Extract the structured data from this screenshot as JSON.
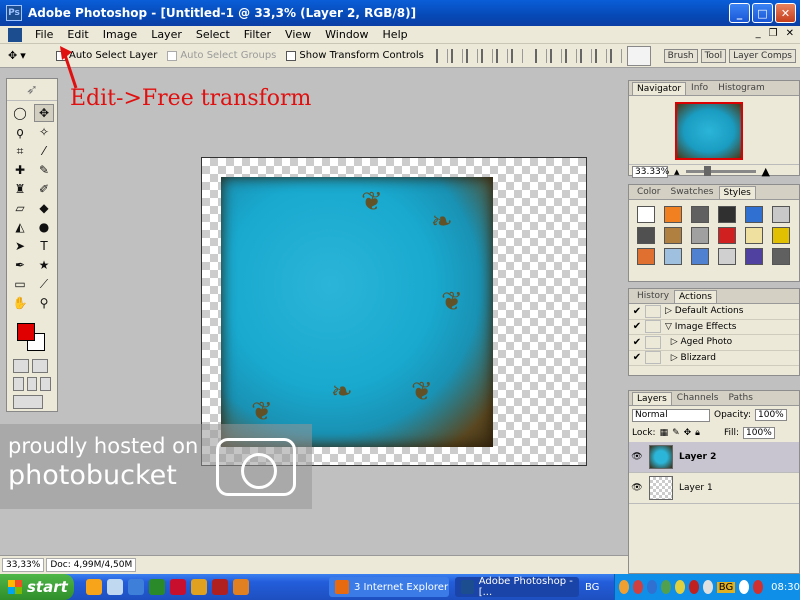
{
  "window": {
    "title": "Adobe Photoshop - [Untitled-1 @ 33,3% (Layer 2, RGB/8)]",
    "controls": [
      "_",
      "□",
      "✕"
    ]
  },
  "menubar": {
    "items": [
      "File",
      "Edit",
      "Image",
      "Layer",
      "Select",
      "Filter",
      "View",
      "Window",
      "Help"
    ]
  },
  "options": {
    "auto_select_layer": "Auto Select Layer",
    "auto_select_groups": "Auto Select Groups",
    "show_transform_controls": "Show Transform Controls",
    "palette_tabs": [
      "Brush",
      "Tool",
      "Layer Comps"
    ]
  },
  "annotation": {
    "text": "Edit->Free transform"
  },
  "watermark": {
    "line1": "proudly hosted on",
    "line2": "photobucket"
  },
  "navigator": {
    "tabs": [
      "Navigator",
      "Info",
      "Histogram"
    ],
    "zoom": "33.33%"
  },
  "styles_panel": {
    "tabs": [
      "Color",
      "Swatches",
      "Styles"
    ],
    "swatches": [
      "#ffffff",
      "#f08020",
      "#606060",
      "#303030",
      "#3070d0",
      "#c8c8c8",
      "#505050",
      "#b08040",
      "#a0a0a0",
      "#d02020",
      "#f0e0a0",
      "#e0c000",
      "#e07030",
      "#a0c0e0",
      "#5080d0",
      "#d0d0d0",
      "#5040a0",
      "#606060"
    ]
  },
  "actions": {
    "tabs": [
      "History",
      "Actions"
    ],
    "rows": [
      "Default Actions",
      "Image Effects",
      "Aged Photo",
      "Blizzard"
    ]
  },
  "layers": {
    "tabs": [
      "Layers",
      "Channels",
      "Paths"
    ],
    "blend_mode": "Normal",
    "opacity_label": "Opacity:",
    "opacity_value": "100%",
    "lock_label": "Lock:",
    "fill_label": "Fill:",
    "fill_value": "100%",
    "items": [
      {
        "name": "Layer 2",
        "selected": true
      },
      {
        "name": "Layer 1",
        "selected": false
      }
    ]
  },
  "status": {
    "zoom": "33,33%",
    "doc": "Doc: 4,99M/4,50M"
  },
  "taskbar": {
    "start_label": "start",
    "tasks": [
      "3 Internet Explorer",
      "Adobe Photoshop - [..."
    ],
    "lang": "BG",
    "tray_lang": "BG",
    "clock": "08:30"
  }
}
